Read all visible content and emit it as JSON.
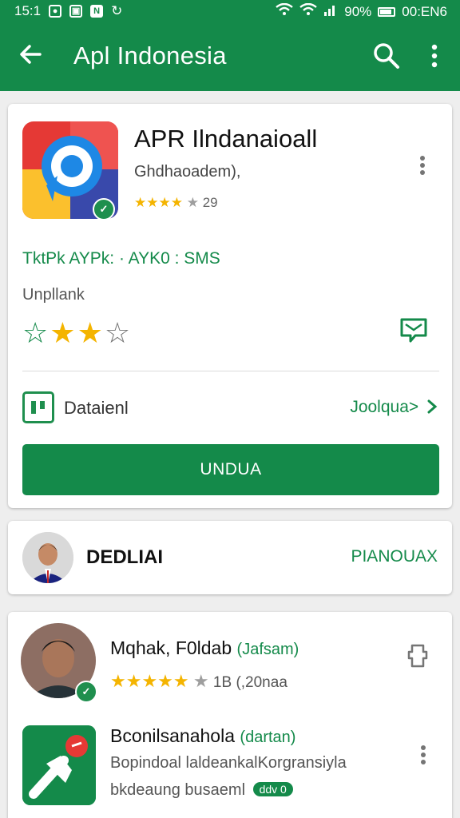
{
  "status_bar": {
    "time": "15:1",
    "battery_text": "90%",
    "right_text": "00:EN6"
  },
  "header": {
    "title": "Apl Indonesia"
  },
  "app_card": {
    "title": "APR Ilndanaioall",
    "developer": "Ghdhaoadem),",
    "rating_count": "29",
    "tags": "TktPk AYPk: · AYK0 : SMS",
    "subtitle": "Unpllank",
    "details_label": "Dataienl",
    "details_link": "Joolqua>",
    "install_button": "UNDUA"
  },
  "developer_card": {
    "name": "DEDLIAI",
    "action": "PIANOUAX"
  },
  "list": {
    "item1": {
      "title": "Mqhak, F0ldab",
      "tag": "(Jafsam)",
      "rating_text": "1B (,20naa"
    },
    "item2": {
      "title": "Bconilsanahola",
      "tag": "(dartan)",
      "desc_line1": "Bopindoal laldeankalKorgransiyla",
      "desc_line2": "bkdeaung busaeml",
      "pill": "ddv 0"
    }
  },
  "colors": {
    "primary": "#148a4a",
    "star": "#f4b400"
  }
}
